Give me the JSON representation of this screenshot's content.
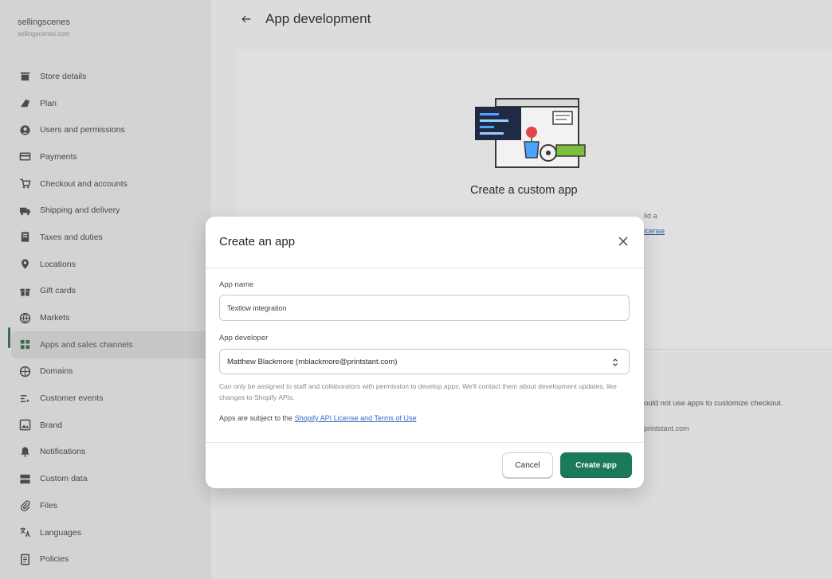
{
  "store": {
    "name": "sellingscenes",
    "email": "sellingscenes.com"
  },
  "sidebar": {
    "items": [
      {
        "label": "Store details",
        "icon": "store-icon"
      },
      {
        "label": "Plan",
        "icon": "plan-icon"
      },
      {
        "label": "Users and permissions",
        "icon": "user-icon"
      },
      {
        "label": "Payments",
        "icon": "payments-icon"
      },
      {
        "label": "Checkout and accounts",
        "icon": "checkout-icon"
      },
      {
        "label": "Shipping and delivery",
        "icon": "truck-icon"
      },
      {
        "label": "Taxes and duties",
        "icon": "taxes-icon"
      },
      {
        "label": "Locations",
        "icon": "location-pin-icon"
      },
      {
        "label": "Gift cards",
        "icon": "gift-icon"
      },
      {
        "label": "Markets",
        "icon": "globe-icon"
      },
      {
        "label": "Apps and sales channels",
        "icon": "apps-icon"
      },
      {
        "label": "Domains",
        "icon": "domains-icon"
      },
      {
        "label": "Customer events",
        "icon": "customer-events-icon"
      },
      {
        "label": "Brand",
        "icon": "brand-icon"
      },
      {
        "label": "Notifications",
        "icon": "bell-icon"
      },
      {
        "label": "Custom data",
        "icon": "custom-data-icon"
      },
      {
        "label": "Files",
        "icon": "paperclip-icon"
      },
      {
        "label": "Languages",
        "icon": "languages-icon"
      },
      {
        "label": "Policies",
        "icon": "policies-icon"
      }
    ],
    "active_index": 10
  },
  "header": {
    "title": "App development",
    "back_icon": "arrow-left-icon"
  },
  "main": {
    "custom_app_title": "Create a custom app",
    "fragment_a": "lid a",
    "fragment_b": "icense",
    "fragment_c": "ould not use apps to customize checkout.",
    "fragment_d": "printstant.com"
  },
  "modal": {
    "title": "Create an app",
    "app_name_label": "App name",
    "app_name_value": "Textlow integration",
    "developer_label": "App developer",
    "developer_value": "Matthew Blackmore (mblackmore@printstant.com)",
    "helper_text": "Can only be assigned to staff and collaborators with permission to develop apps. We'll contact them about development updates, like changes to Shopify APIs.",
    "terms_prefix": "Apps are subject to the ",
    "terms_link": "Shopify API License and Terms of Use",
    "cancel_label": "Cancel",
    "create_label": "Create app"
  },
  "colors": {
    "primary": "#1a7a5a",
    "link": "#2c6ecb",
    "overlay": "#d3d3d3"
  }
}
